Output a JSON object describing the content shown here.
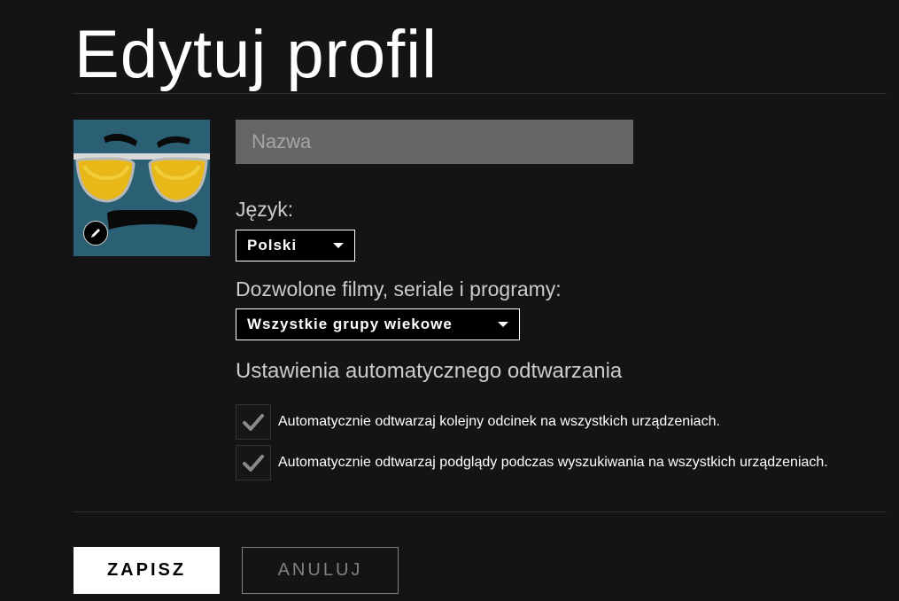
{
  "page": {
    "title": "Edytuj profil"
  },
  "profile": {
    "name_placeholder": "Nazwa",
    "name_value": ""
  },
  "language": {
    "label": "Język:",
    "selected": "Polski"
  },
  "maturity": {
    "label": "Dozwolone filmy, seriale i programy:",
    "selected": "Wszystkie grupy wiekowe"
  },
  "autoplay": {
    "heading": "Ustawienia automatycznego odtwarzania",
    "options": [
      {
        "label": "Automatycznie odtwarzaj kolejny odcinek na wszystkich urządzeniach.",
        "checked": true
      },
      {
        "label": "Automatycznie odtwarzaj podglądy podczas wyszukiwania na wszystkich urządzeniach.",
        "checked": true
      }
    ]
  },
  "actions": {
    "save_label": "ZAPISZ",
    "cancel_label": "ANULUJ"
  },
  "icons": {
    "avatar": "sunglasses-mustache-avatar",
    "edit": "pencil-icon",
    "check": "checkmark-icon",
    "caret": "caret-down-icon"
  },
  "colors": {
    "background": "#141414",
    "input_bg": "#666666",
    "avatar_bg": "#2a5f74",
    "lens": "#e8b818"
  }
}
